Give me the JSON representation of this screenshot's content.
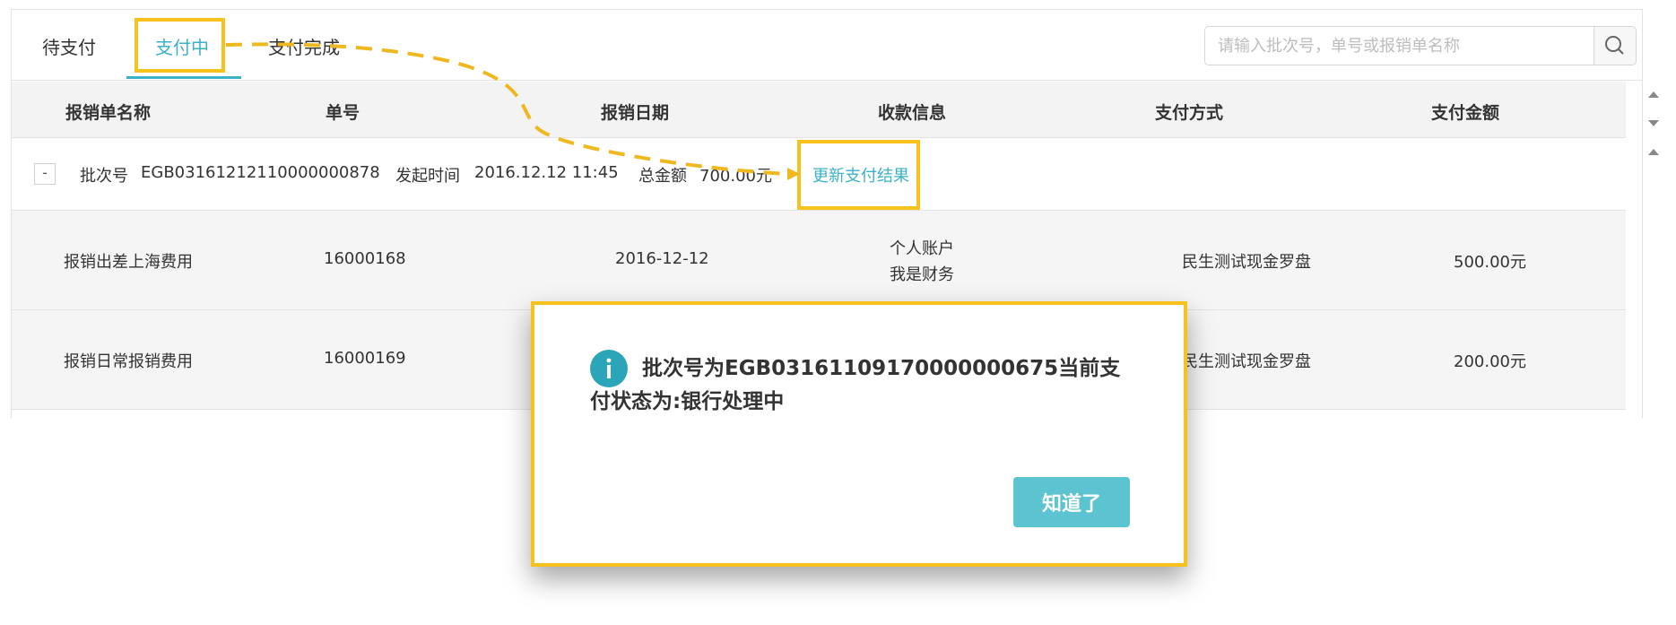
{
  "tabs": [
    {
      "label": "待支付",
      "active": false
    },
    {
      "label": "支付中",
      "active": true
    },
    {
      "label": "支付完成",
      "active": false
    }
  ],
  "search": {
    "placeholder": "请输入批次号，单号或报销单名称",
    "value": ""
  },
  "table": {
    "headers": [
      "报销单名称",
      "单号",
      "报销日期",
      "收款信息",
      "支付方式",
      "支付金额"
    ],
    "batch": {
      "toggle": "-",
      "batch_label": "批次号",
      "batch_no": "EGB03161212110000000878",
      "time_label": "发起时间",
      "time_value": "2016.12.12 11:45",
      "total_label": "总金额",
      "total_value": "700.00元",
      "update_link": "更新支付结果"
    },
    "rows": [
      {
        "name": "报销出差上海费用",
        "no": "16000168",
        "date": "2016-12-12",
        "payee_line1": "个人账户",
        "payee_line2": "我是财务",
        "method": "民生测试现金罗盘",
        "amount": "500.00元"
      },
      {
        "name": "报销日常报销费用",
        "no": "16000169",
        "date": "",
        "payee_line1": "",
        "payee_line2": "",
        "method": "民生测试现金罗盘",
        "amount": "200.00元"
      }
    ]
  },
  "dialog": {
    "message": "批次号为EGB03161109170000000675当前支付状态为:银行处理中",
    "ok_label": "知道了",
    "icon": "info-icon"
  },
  "colors": {
    "accent": "#3bb2c8",
    "highlight": "#f7c21b",
    "button": "#5cc3d0"
  }
}
